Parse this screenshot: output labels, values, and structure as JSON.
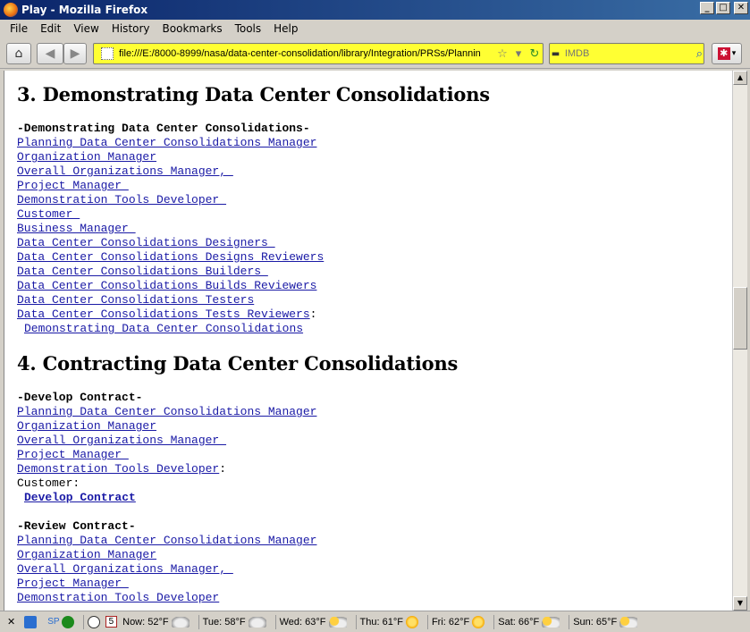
{
  "window": {
    "title": "Play - Mozilla Firefox",
    "min_glyph": "_",
    "max_glyph": "□",
    "close_glyph": "✕"
  },
  "menu": [
    "File",
    "Edit",
    "View",
    "History",
    "Bookmarks",
    "Tools",
    "Help"
  ],
  "nav": {
    "home_glyph": "⌂",
    "back_glyph": "◀",
    "forward_glyph": "▶",
    "url": "file:///E:/8000-8999/nasa/data-center-consolidation/library/Integration/PRSs/Plannin",
    "star_glyph": "☆",
    "dropdown_glyph": "▾",
    "reload_glyph": "↻",
    "search_placeholder": "IMDB",
    "search_engine_glyph": "▬",
    "search_glyph": "⌕",
    "addon_glyph": "✱",
    "addon_dropdown_glyph": "▾"
  },
  "sections": [
    {
      "heading": "3. Demonstrating Data Center Consolidations",
      "groups": [
        {
          "label": "-Demonstrating Data Center Consolidations-",
          "links": [
            "Planning Data Center Consolidations Manager",
            "Organization Manager",
            "Overall Organizations Manager, ",
            "Project Manager ",
            "Demonstration Tools Developer ",
            "Customer ",
            "Business Manager ",
            "Data Center Consolidations Designers ",
            "Data Center Consolidations Designs Reviewers",
            "Data Center Consolidations Builders ",
            "Data Center Consolidations Builds Reviewers",
            "Data Center Consolidations Testers",
            "Data Center Consolidations Tests Reviewers"
          ],
          "last_suffix": ":",
          "action_link": "Demonstrating Data Center Consolidations"
        }
      ]
    },
    {
      "heading": "4. Contracting Data Center Consolidations",
      "groups": [
        {
          "label": "-Develop Contract-",
          "links": [
            "Planning Data Center Consolidations Manager",
            "Organization Manager",
            "Overall Organizations Manager ",
            "Project Manager ",
            "Demonstration Tools Developer"
          ],
          "last_suffix": ":",
          "plain_line": "Customer:",
          "action_link": "Develop Contract"
        },
        {
          "label": "-Review Contract-",
          "links": [
            "Planning Data Center Consolidations Manager",
            "Organization Manager",
            "Overall Organizations Manager, ",
            "Project Manager ",
            "Demonstration Tools Developer"
          ]
        }
      ]
    }
  ],
  "scroll": {
    "up_glyph": "▲",
    "down_glyph": "▼",
    "position_fraction": 0.45
  },
  "status": {
    "close_glyph": "✕",
    "sp_label": "SP",
    "calendar_day": "5",
    "weather": [
      {
        "label": "Now: 52°F",
        "icon": "cloud-icon"
      },
      {
        "label": "Tue: 58°F",
        "icon": "cloud-icon"
      },
      {
        "label": "Wed: 63°F",
        "icon": "suncloud-icon"
      },
      {
        "label": "Thu: 61°F",
        "icon": "sun-icon"
      },
      {
        "label": "Fri: 62°F",
        "icon": "sun-icon"
      },
      {
        "label": "Sat: 66°F",
        "icon": "suncloud-icon"
      },
      {
        "label": "Sun: 65°F",
        "icon": "suncloud-icon"
      }
    ]
  },
  "colors": {
    "link": "#1a1aa6",
    "urlbar_bg": "#ffff33",
    "titlebar": "#0a246a"
  }
}
